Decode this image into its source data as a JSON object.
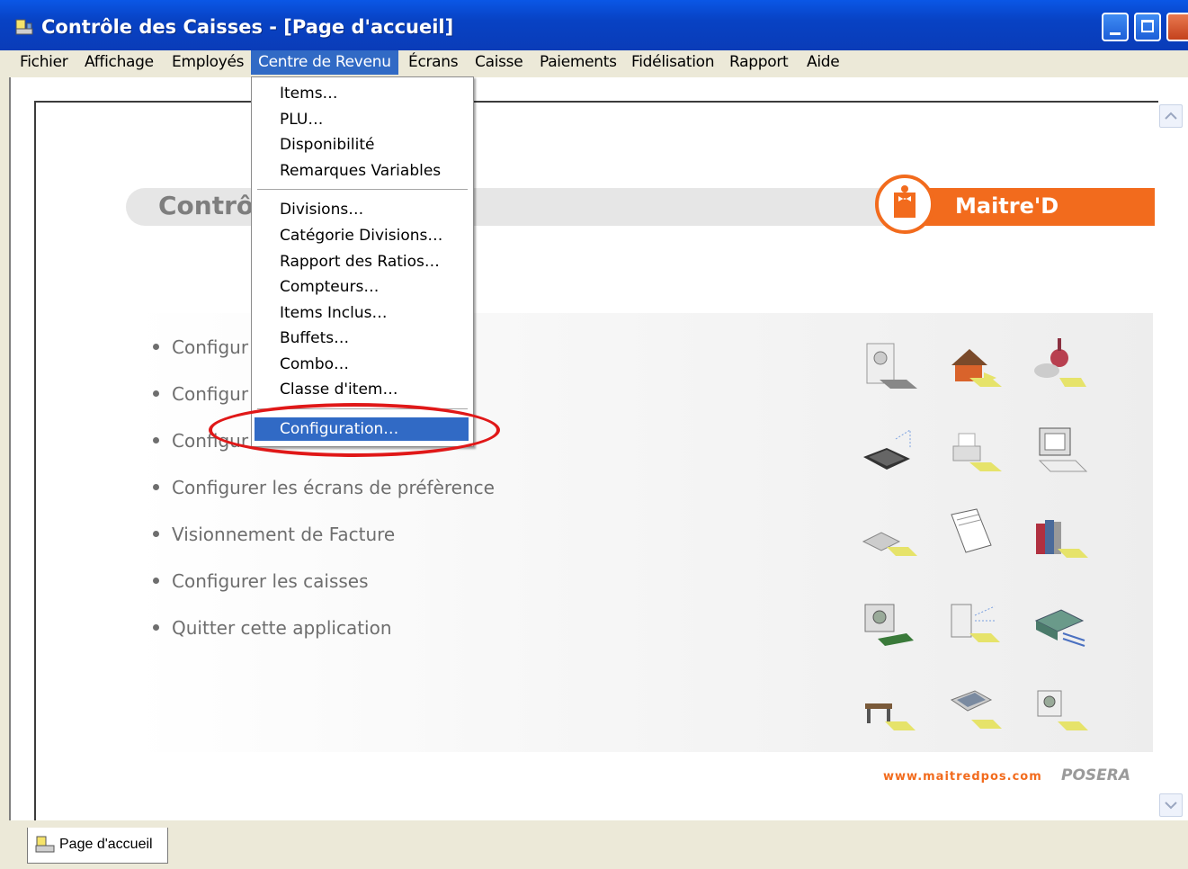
{
  "window": {
    "title": "Contrôle des Caisses - [Page d'accueil]",
    "icon": "register-app-icon"
  },
  "menubar": {
    "items": [
      {
        "label": "Fichier"
      },
      {
        "label": "Affichage"
      },
      {
        "label": "Employés"
      },
      {
        "label": "Centre de Revenu",
        "active": true
      },
      {
        "label": "Écrans"
      },
      {
        "label": "Caisse"
      },
      {
        "label": "Paiements"
      },
      {
        "label": "Fidélisation"
      },
      {
        "label": "Rapport"
      },
      {
        "label": "Aide"
      }
    ]
  },
  "dropdown": {
    "group1": [
      "Items…",
      "PLU…",
      "Disponibilité",
      "Remarques Variables"
    ],
    "group2": [
      "Divisions…",
      "Catégorie Divisions…",
      "Rapport des Ratios…",
      "Compteurs…",
      "Items Inclus…",
      "Buffets…",
      "Combo…",
      "Classe d'item…"
    ],
    "selected": "Configuration…"
  },
  "banner": {
    "title": "Contrô",
    "logo_text": "Maitre'D",
    "accent_color": "#f26b1d"
  },
  "links": [
    "Configur",
    "Configur",
    "Configur",
    "Configurer les écrans de préfèrence",
    "Visionnement de Facture",
    "Configurer les caisses",
    "Quitter cette application"
  ],
  "footer": {
    "url": "www.maitredpos.com",
    "brand": "POSERA"
  },
  "tab": {
    "label": "Page d'accueil"
  },
  "highlight_color": "#316ac5"
}
